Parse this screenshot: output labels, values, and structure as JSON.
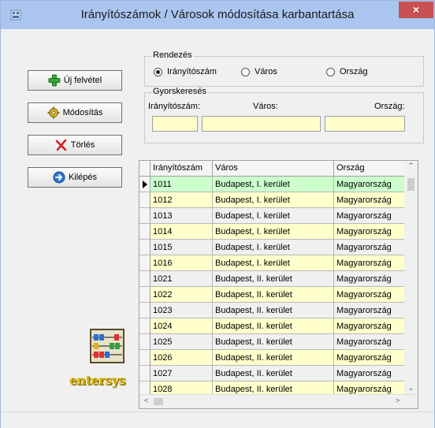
{
  "window": {
    "title": "Irányítószámok / Városok módosítása karbantartása",
    "close_glyph": "×"
  },
  "buttons": {
    "new": {
      "label": "Új felvétel",
      "icon": "plus-icon"
    },
    "modify": {
      "label": "Módosítás",
      "icon": "gear-icon"
    },
    "delete": {
      "label": "Törlés",
      "icon": "x-icon"
    },
    "exit": {
      "label": "Kilépés",
      "icon": "arrow-right-icon"
    }
  },
  "sort_group": {
    "legend": "Rendezés",
    "options": [
      {
        "label": "Irányítószám",
        "selected": true
      },
      {
        "label": "Város",
        "selected": false
      },
      {
        "label": "Ország",
        "selected": false
      }
    ]
  },
  "quick_search": {
    "legend": "Gyorskeresés",
    "zip_label": "Irányítószám:",
    "city_label": "Város:",
    "country_label": "Ország:",
    "zip_value": "",
    "city_value": "",
    "country_value": ""
  },
  "grid": {
    "columns": [
      "Irányítószám",
      "Város",
      "Ország"
    ],
    "rows": [
      [
        "1011",
        "Budapest, I. kerület",
        "Magyarország"
      ],
      [
        "1012",
        "Budapest, I. kerület",
        "Magyarország"
      ],
      [
        "1013",
        "Budapest, I. kerület",
        "Magyarország"
      ],
      [
        "1014",
        "Budapest, I. kerület",
        "Magyarország"
      ],
      [
        "1015",
        "Budapest, I. kerület",
        "Magyarország"
      ],
      [
        "1016",
        "Budapest, I. kerület",
        "Magyarország"
      ],
      [
        "1021",
        "Budapest, II. kerület",
        "Magyarország"
      ],
      [
        "1022",
        "Budapest, II. kerület",
        "Magyarország"
      ],
      [
        "1023",
        "Budapest, II. kerület",
        "Magyarország"
      ],
      [
        "1024",
        "Budapest, II. kerület",
        "Magyarország"
      ],
      [
        "1025",
        "Budapest, II. kerület",
        "Magyarország"
      ],
      [
        "1026",
        "Budapest, II. kerület",
        "Magyarország"
      ],
      [
        "1027",
        "Budapest, II. kerület",
        "Magyarország"
      ],
      [
        "1028",
        "Budapest, II. kerület",
        "Magyarország"
      ]
    ],
    "selected_row": 0
  },
  "logo": {
    "text": "entersys"
  },
  "colors": {
    "selected_row": "#ccffcc",
    "alt_row": "#ffffcc",
    "row": "#f0f0f0",
    "input_bg": "#ffffcc",
    "titlebar": "#aac6f0",
    "close": "#c75050"
  }
}
